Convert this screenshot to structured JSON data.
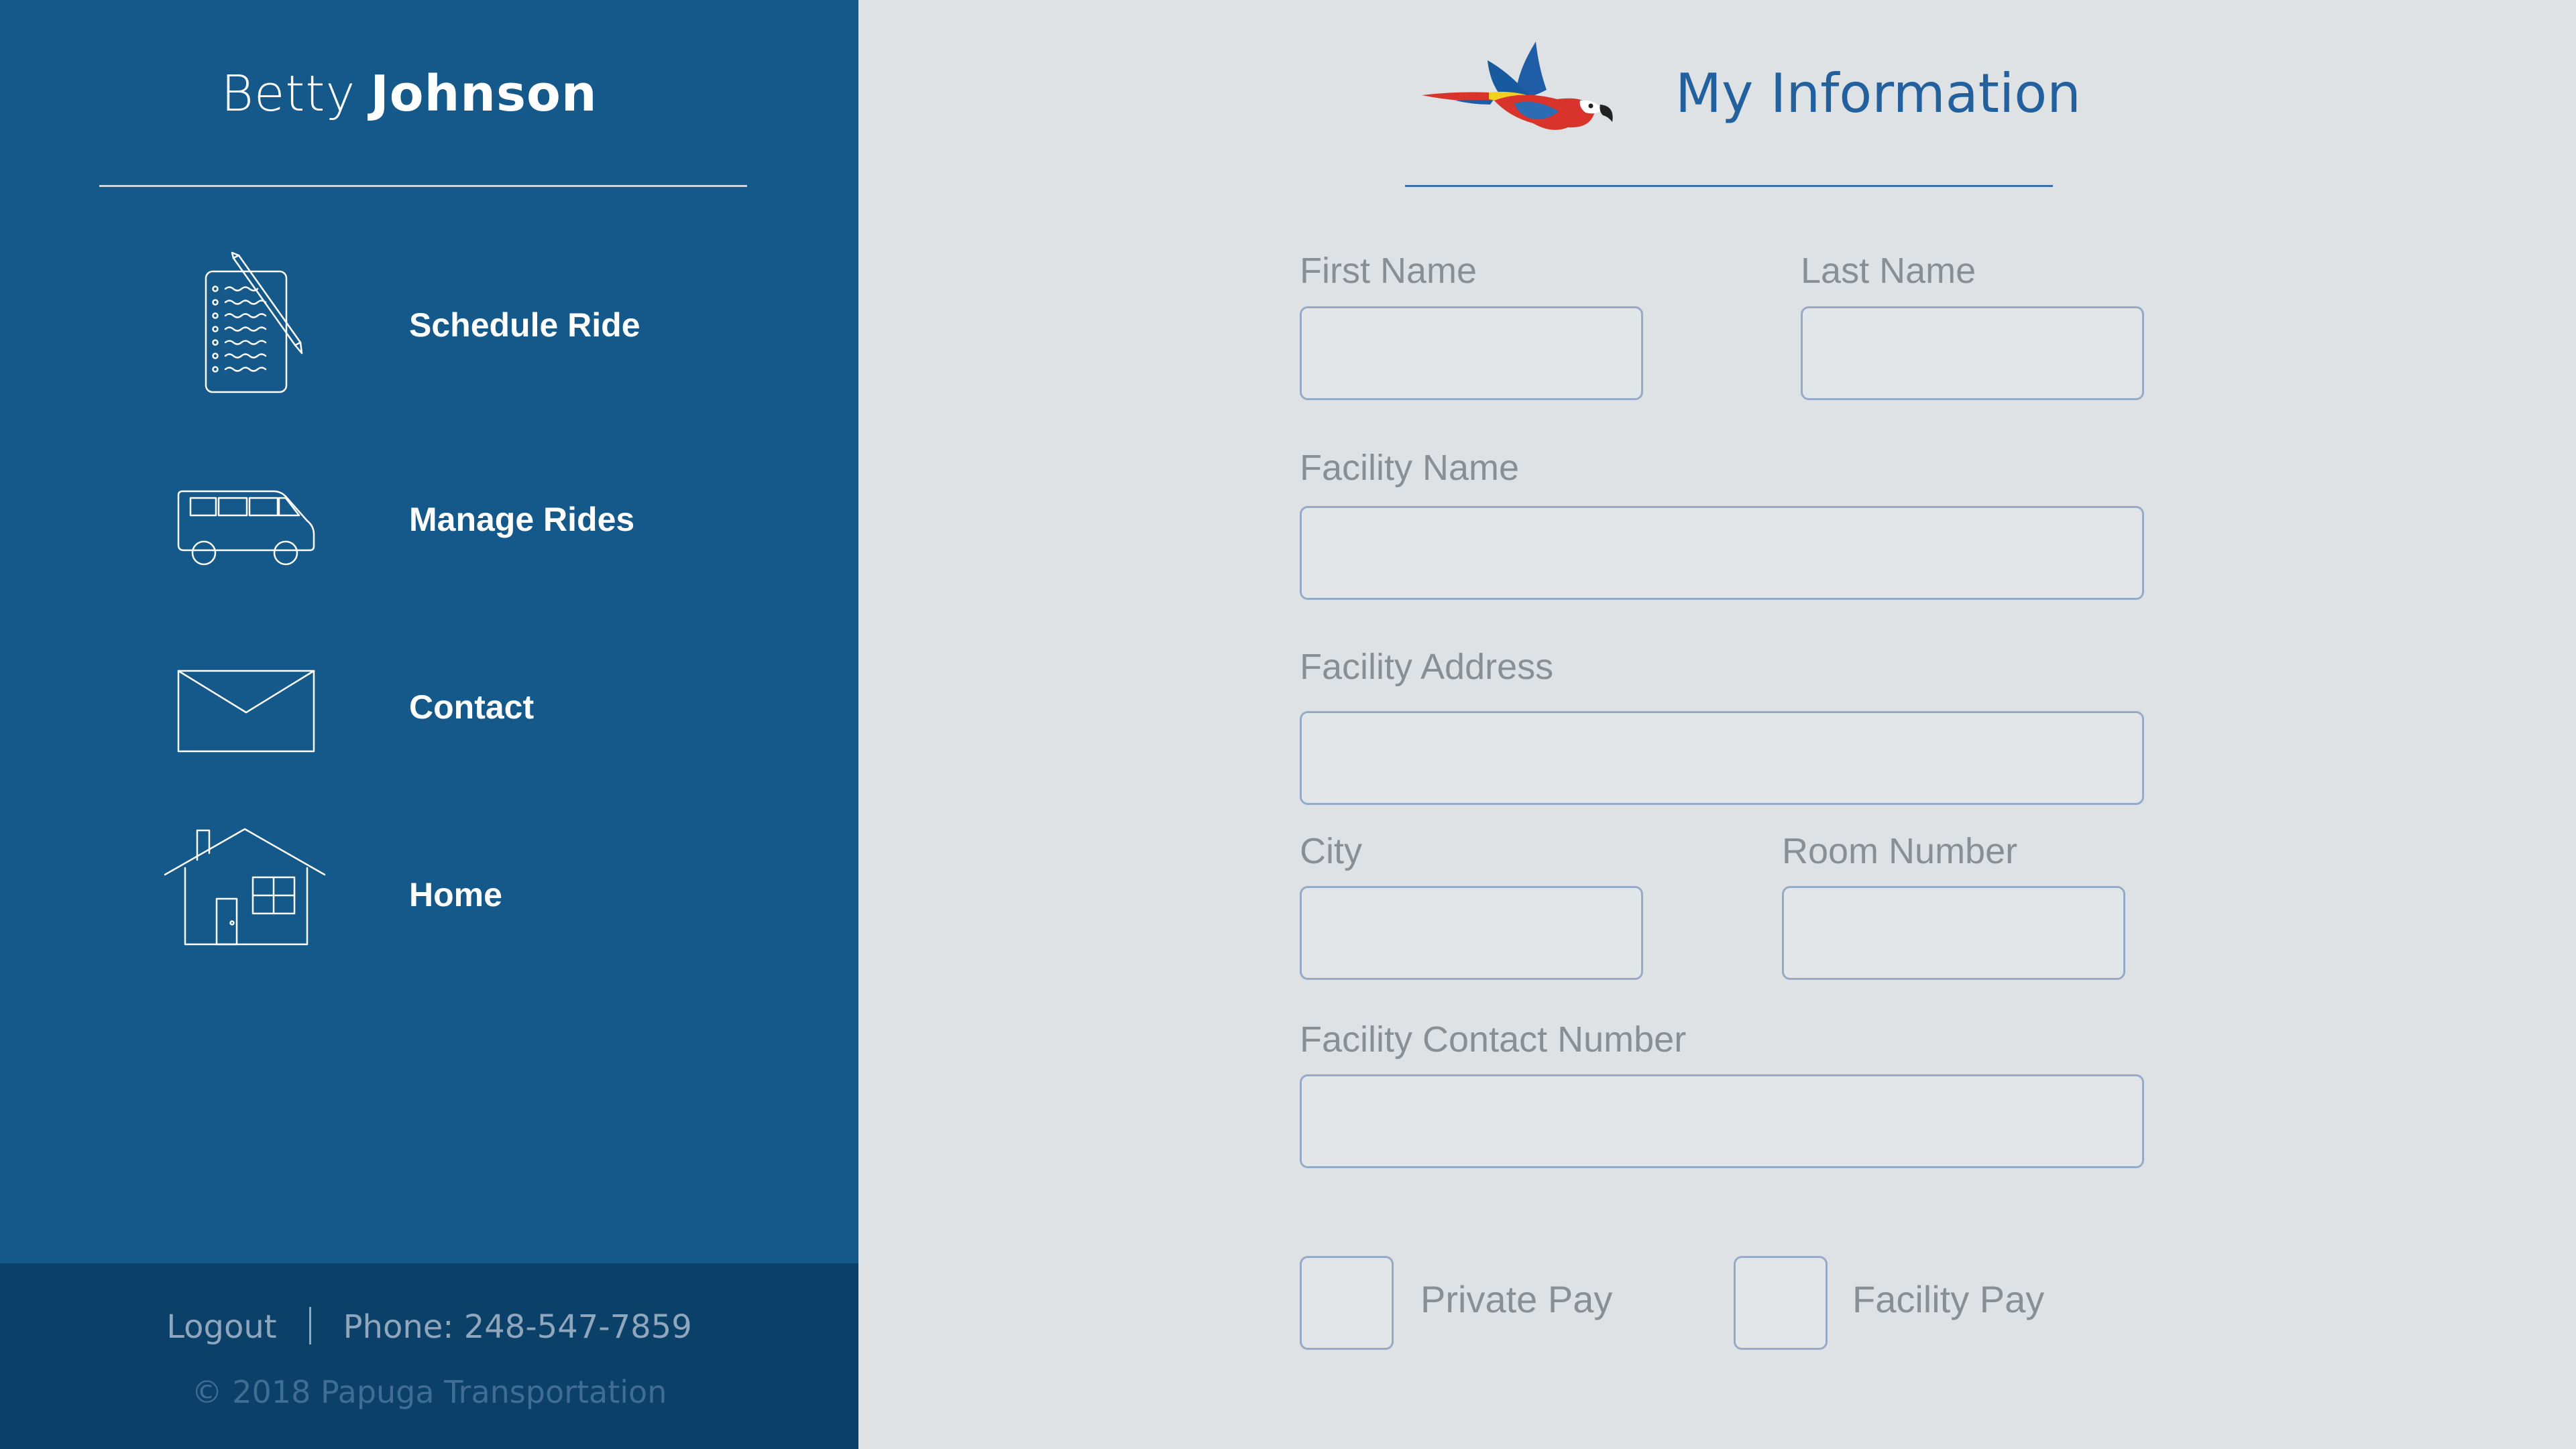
{
  "user": {
    "first_name": "Betty",
    "last_name": "Johnson"
  },
  "sidebar": {
    "items": [
      {
        "label": "Schedule Ride",
        "icon": "clipboard-checklist-icon"
      },
      {
        "label": "Manage Rides",
        "icon": "van-icon"
      },
      {
        "label": "Contact",
        "icon": "envelope-icon"
      },
      {
        "label": "Home",
        "icon": "house-icon"
      }
    ],
    "footer": {
      "logout": "Logout",
      "phone": "Phone: 248-547-7859",
      "copyright": "© 2018 Papuga Transportation"
    }
  },
  "main": {
    "logo_icon": "parrot-logo-icon",
    "title": "My Information",
    "fields": {
      "first_name": {
        "label": "First Name",
        "value": ""
      },
      "last_name": {
        "label": "Last Name",
        "value": ""
      },
      "facility_name": {
        "label": "Facility Name",
        "value": ""
      },
      "facility_address": {
        "label": "Facility Address",
        "value": ""
      },
      "city": {
        "label": "City",
        "value": ""
      },
      "room_number": {
        "label": "Room Number",
        "value": ""
      },
      "facility_contact_number": {
        "label": "Facility Contact Number",
        "value": ""
      }
    },
    "payment": {
      "private_pay": {
        "label": "Private Pay",
        "checked": false
      },
      "facility_pay": {
        "label": "Facility Pay",
        "checked": false
      }
    }
  },
  "colors": {
    "sidebar_bg": "#15588a",
    "sidebar_footer_bg": "#0b4068",
    "main_bg": "#dfe2e4",
    "title_blue": "#23609e",
    "input_border": "#95aac7",
    "label_gray": "#8a8f94",
    "parrot_red": "#d8342b",
    "parrot_blue": "#1f5ea6",
    "parrot_yellow": "#f2d01f"
  }
}
